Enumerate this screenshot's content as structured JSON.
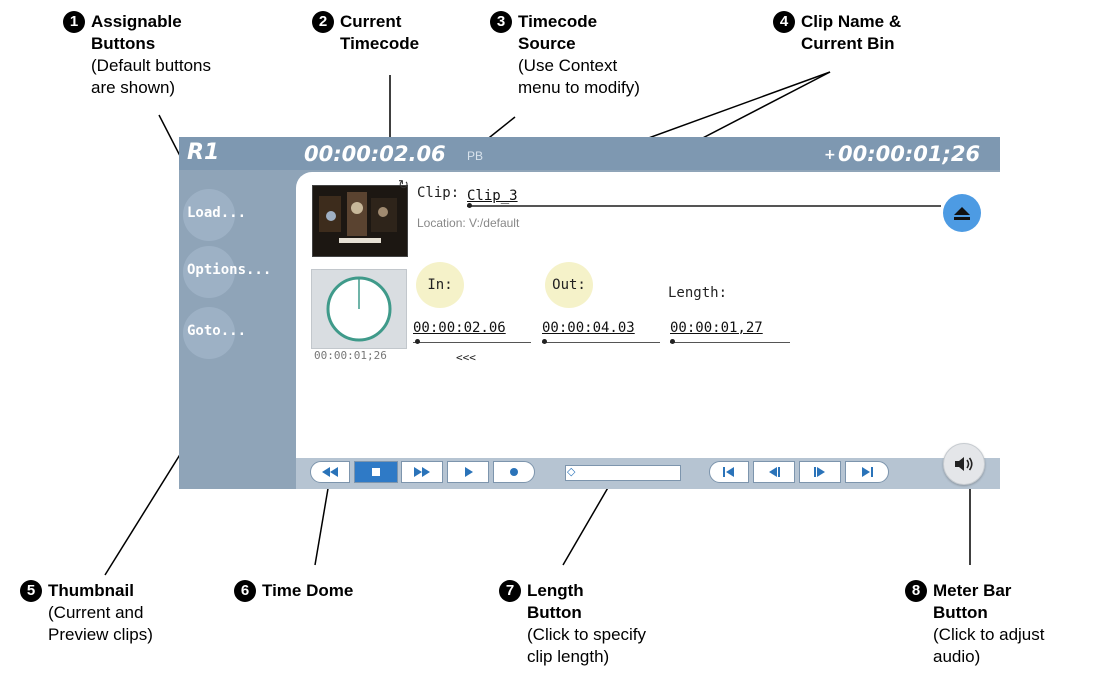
{
  "callouts": [
    {
      "num": "1",
      "title": "Assignable\nButtons",
      "sub": "(Default buttons\nare shown)"
    },
    {
      "num": "2",
      "title": "Current\nTimecode",
      "sub": ""
    },
    {
      "num": "3",
      "title": "Timecode\nSource",
      "sub": "(Use Context\nmenu to modify)"
    },
    {
      "num": "4",
      "title": "Clip Name &\nCurrent Bin",
      "sub": ""
    },
    {
      "num": "5",
      "title": "Thumbnail",
      "sub": "(Current and\nPreview clips)"
    },
    {
      "num": "6",
      "title": "Time Dome",
      "sub": ""
    },
    {
      "num": "7",
      "title": "Length\nButton",
      "sub": "(Click to specify\nclip length)"
    },
    {
      "num": "8",
      "title": "Meter Bar\nButton",
      "sub": "(Click to adjust\naudio)"
    }
  ],
  "player": {
    "channel": "R1",
    "current_timecode": "00:00:02.06",
    "timecode_source": "PB",
    "remaining_timecode": "00:00:01;26",
    "remaining_marker": "+",
    "side_buttons": [
      "Load...",
      "Options...",
      "Goto..."
    ],
    "clip_label": "Clip:",
    "clip_name": "Clip_3",
    "location": "Location: V:/default",
    "in_label": "In:",
    "out_label": "Out:",
    "length_label": "Length:",
    "in_value": "00:00:02.06",
    "out_value": "00:00:04.03",
    "length_value": "00:00:01,27",
    "dome_time": "00:00:01;26",
    "rewind_marker": "<<<",
    "position_fraction": 0.0
  },
  "colors": {
    "panel": "#8fa4b8",
    "topbar": "#7e98b1",
    "accent_blue": "#2f7ac6",
    "pill": "#f5f2c9"
  },
  "icons": {
    "eject": "eject-icon",
    "meter": "speaker-icon",
    "transport": [
      "rewind-icon",
      "stop-icon",
      "fast-forward-icon",
      "play-icon",
      "record-icon"
    ],
    "navigation": [
      "go-to-start-icon",
      "step-back-icon",
      "step-forward-icon",
      "go-to-end-icon"
    ]
  }
}
